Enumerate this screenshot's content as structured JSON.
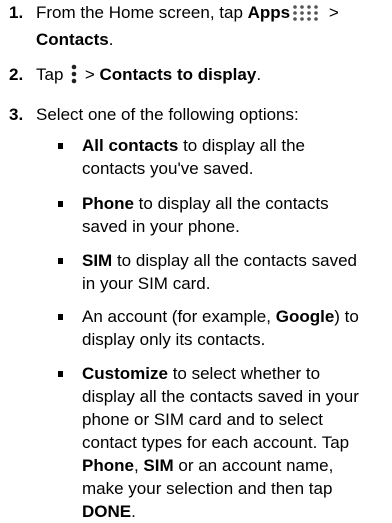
{
  "steps": [
    {
      "num": "1.",
      "l1_a": "From the Home screen, tap ",
      "l1_b": "Apps",
      "l1_c": " >",
      "l2_b": "Contacts",
      "l2_c": "."
    },
    {
      "num": "2.",
      "a": "Tap ",
      "b": " > ",
      "c": "Contacts to display",
      "d": "."
    },
    {
      "num": "3.",
      "text": "Select one of the following options:"
    }
  ],
  "options": [
    {
      "bold": "All contacts",
      "l1": " to display all the",
      "l2": "contacts you've saved."
    },
    {
      "bold": "Phone",
      "l1": " to display all the contacts",
      "l2": "saved in your phone."
    },
    {
      "bold": "SIM",
      "l1": " to display all the contacts saved",
      "l2": "in your SIM card."
    },
    {
      "l1_a": "An account (for example, ",
      "bold": "Google",
      "l1_b": ") to",
      "l2": "display only its contacts."
    },
    {
      "bold": "Customize",
      "l1": " to select whether to",
      "l2": "display all the contacts saved in your",
      "l3": "phone or SIM card and to select",
      "l4": "contact types for each account. Tap",
      "l5_b1": "Phone",
      "l5_t1": ", ",
      "l5_b2": "SIM",
      "l5_t2": " or an account name,",
      "l6": "make your selection and then tap",
      "l7_b": "DONE",
      "l7_t": "."
    }
  ],
  "icons": [
    "apps-grid-icon",
    "overflow-menu-icon"
  ]
}
